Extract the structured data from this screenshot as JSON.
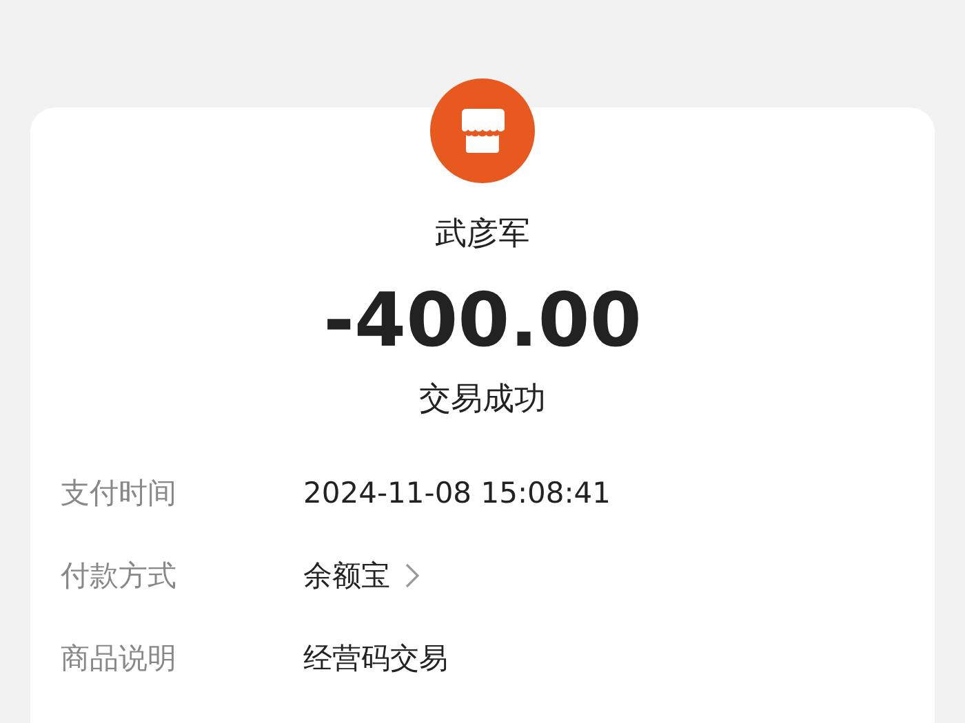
{
  "merchant": {
    "name": "武彦军"
  },
  "amount": "-400.00",
  "status": "交易成功",
  "details": [
    {
      "label": "支付时间",
      "value": "2024-11-08 15:08:41",
      "kind": "text"
    },
    {
      "label": "付款方式",
      "value": "余额宝",
      "kind": "link"
    },
    {
      "label": "商品说明",
      "value": "经营码交易",
      "kind": "text"
    }
  ]
}
